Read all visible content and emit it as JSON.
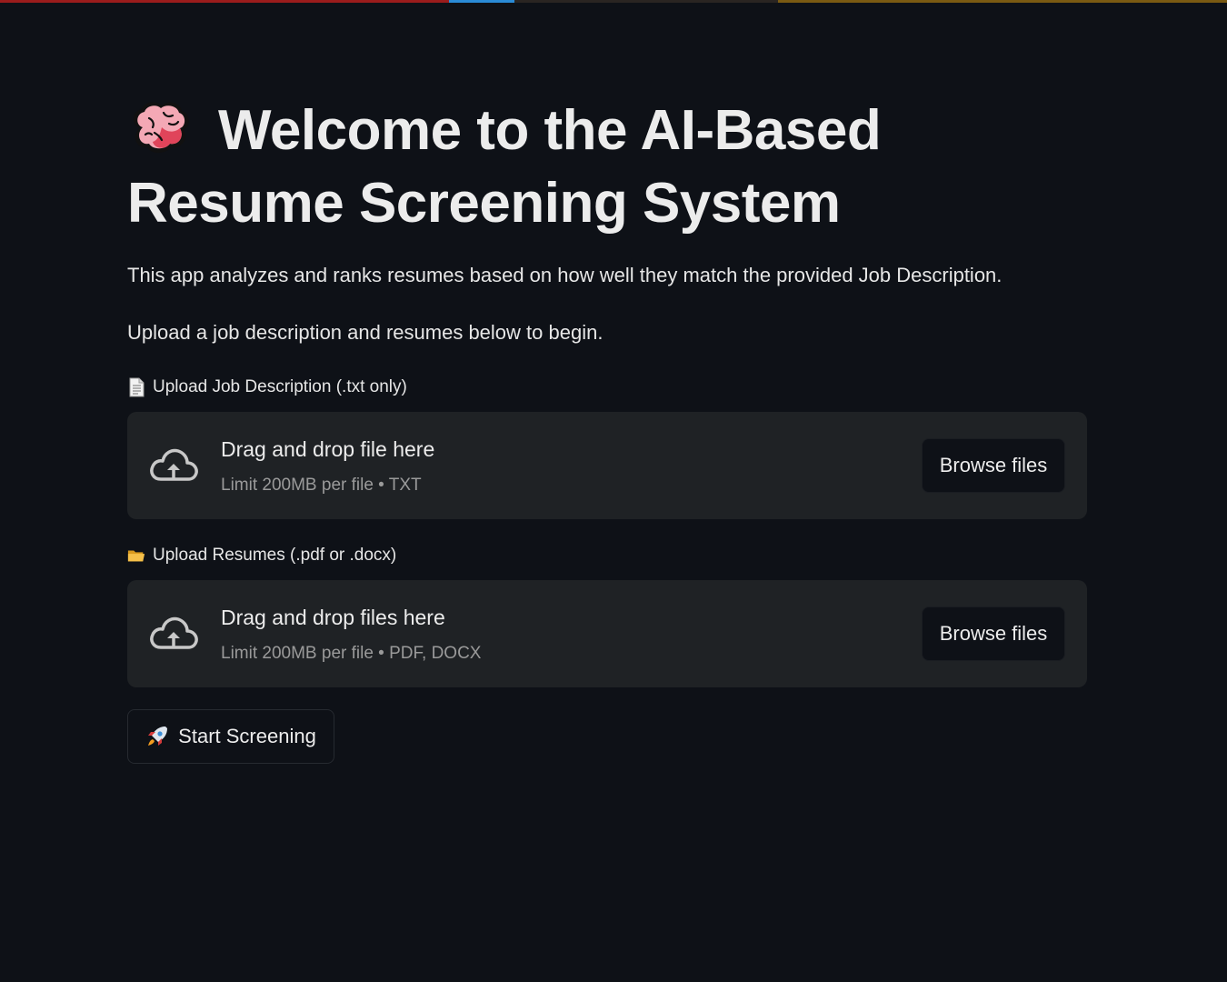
{
  "header": {
    "title": "Welcome to the AI-Based Resume Screening System",
    "title_icon": "brain-icon"
  },
  "intro": {
    "description": "This app analyzes and ranks resumes based on how well they match the provided Job Description.",
    "instruction": "Upload a job description and resumes below to begin."
  },
  "uploaders": [
    {
      "label": "Upload Job Description (.txt only)",
      "label_icon": "page-document-icon",
      "drop_text": "Drag and drop file here",
      "limit_text": "Limit 200MB per file • TXT",
      "button_label": "Browse files"
    },
    {
      "label": "Upload Resumes (.pdf or .docx)",
      "label_icon": "folder-icon",
      "drop_text": "Drag and drop files here",
      "limit_text": "Limit 200MB per file • PDF, DOCX",
      "button_label": "Browse files"
    }
  ],
  "actions": {
    "start_label": "Start Screening",
    "start_icon": "rocket-icon"
  },
  "colors": {
    "background": "#0e1117",
    "dropzone": "#1f2225",
    "text": "#ececec",
    "muted_text": "#9a9a9a"
  }
}
